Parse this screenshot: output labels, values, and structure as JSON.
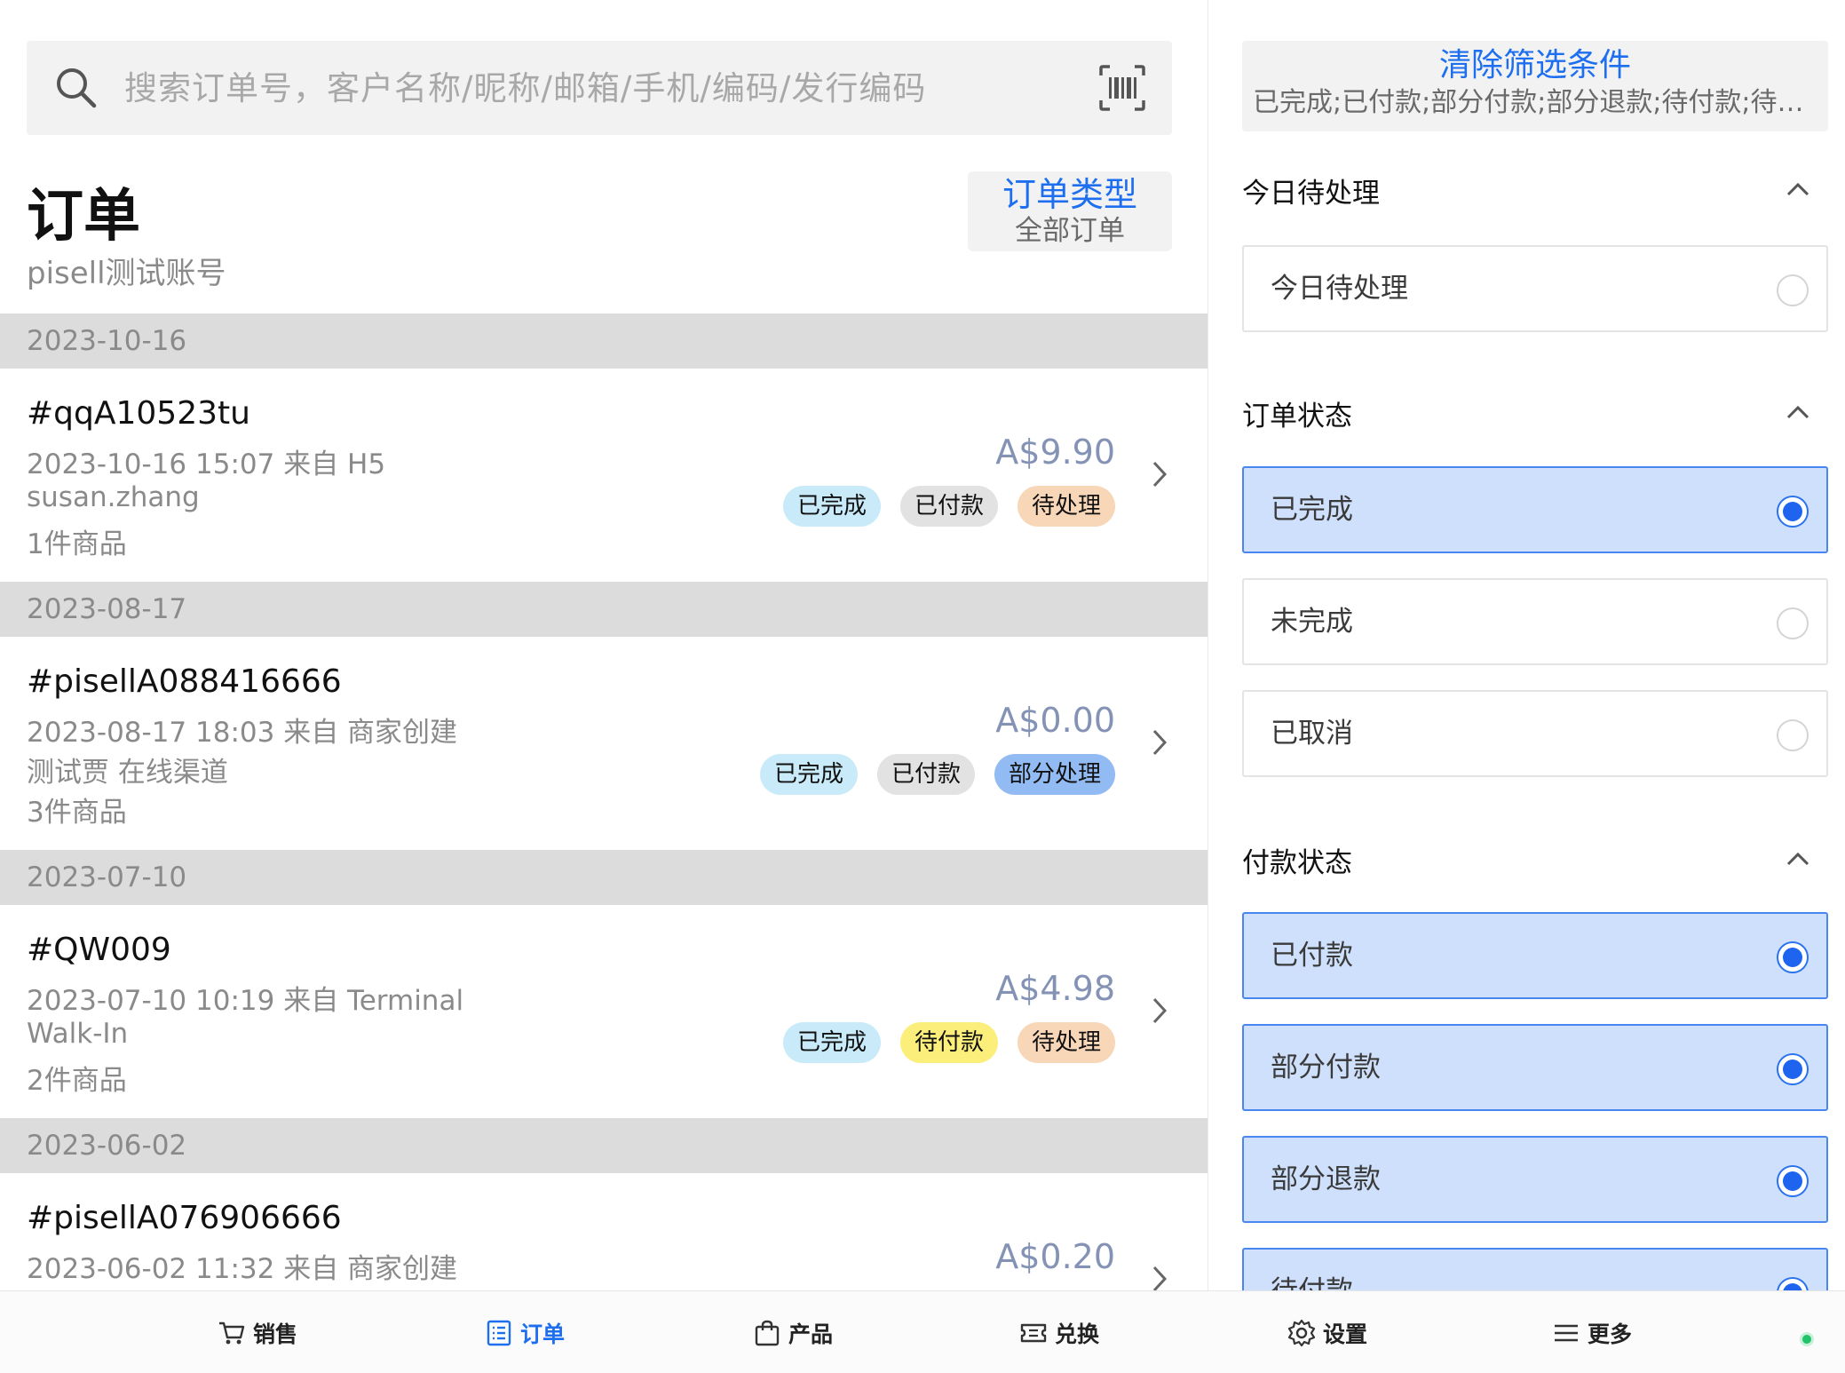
{
  "search": {
    "placeholder": "搜索订单号，客户名称/昵称/邮箱/手机/编码/发行编码"
  },
  "header": {
    "title": "订单",
    "account": "pisell测试账号",
    "order_type_label": "订单类型",
    "order_type_value": "全部订单"
  },
  "order_groups": [
    {
      "date": "2023-10-16",
      "order": {
        "id": "#qqA10523tu",
        "time_source": "2023-10-16 15:07 来自 H5",
        "customer": "susan.zhang",
        "items": "1件商品",
        "amount": "A$9.90",
        "tags": [
          "已完成",
          "已付款",
          "待处理"
        ]
      }
    },
    {
      "date": "2023-08-17",
      "order": {
        "id": "#pisellA088416666",
        "time_source": "2023-08-17 18:03 来自 商家创建",
        "customer": "测试贾 在线渠道",
        "items": "3件商品",
        "amount": "A$0.00",
        "tags": [
          "已完成",
          "已付款",
          "部分处理"
        ]
      }
    },
    {
      "date": "2023-07-10",
      "order": {
        "id": "#QW009",
        "time_source": "2023-07-10 10:19 来自 Terminal",
        "customer": "Walk-In",
        "items": "2件商品",
        "amount": "A$4.98",
        "tags": [
          "已完成",
          "待付款",
          "待处理"
        ]
      }
    },
    {
      "date": "2023-06-02",
      "order": {
        "id": "#pisellA076906666",
        "time_source": "2023-06-02 11:32 来自 商家创建",
        "amount": "A$0.20"
      }
    }
  ],
  "filters": {
    "clear_label": "清除筛选条件",
    "summary": "已完成;已付款;部分付款;部分退款;待付款;待处理",
    "sections": [
      {
        "title": "今日待处理",
        "options": [
          {
            "label": "今日待处理",
            "selected": false
          }
        ]
      },
      {
        "title": "订单状态",
        "options": [
          {
            "label": "已完成",
            "selected": true
          },
          {
            "label": "未完成",
            "selected": false
          },
          {
            "label": "已取消",
            "selected": false
          }
        ]
      },
      {
        "title": "付款状态",
        "options": [
          {
            "label": "已付款",
            "selected": true
          },
          {
            "label": "部分付款",
            "selected": true
          },
          {
            "label": "部分退款",
            "selected": true
          },
          {
            "label": "待付款",
            "selected": true
          }
        ]
      }
    ]
  },
  "nav": {
    "items": [
      {
        "label": "销售",
        "icon": "cart-icon",
        "active": false
      },
      {
        "label": "订单",
        "icon": "order-list-icon",
        "active": true
      },
      {
        "label": "产品",
        "icon": "bag-icon",
        "active": false
      },
      {
        "label": "兑换",
        "icon": "ticket-icon",
        "active": false
      },
      {
        "label": "设置",
        "icon": "gear-icon",
        "active": false
      },
      {
        "label": "更多",
        "icon": "menu-icon",
        "active": false
      }
    ]
  },
  "colors": {
    "accent": "#1e6ff0",
    "selected_option_bg": "#cfe0fc",
    "tag_completed": "#c9ebf9",
    "tag_paid": "#e2e2e2",
    "tag_pending": "#f8d6b8",
    "tag_partial": "#92bbf4",
    "tag_unpaid": "#fbee7a",
    "status_online": "#20c26a"
  }
}
